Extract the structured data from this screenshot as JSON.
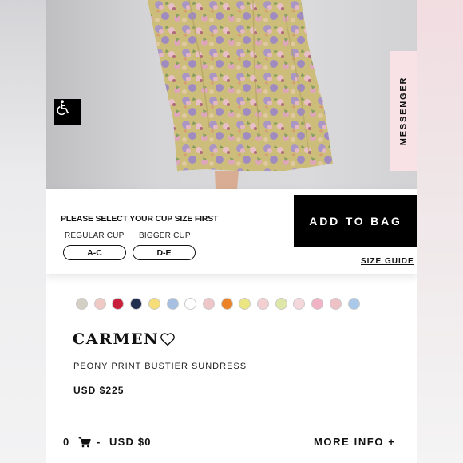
{
  "accessibility": {
    "icon": "wheelchair-icon"
  },
  "messenger": {
    "label": "MESSENGER"
  },
  "size_selector": {
    "prompt": "PLEASE SELECT YOUR CUP SIZE FIRST",
    "regular": {
      "label": "REGULAR CUP",
      "button": "A-C"
    },
    "bigger": {
      "label": "BIGGER CUP",
      "button": "D-E"
    },
    "size_guide": "SIZE GUIDE"
  },
  "add_to_bag": "ADD TO BAG",
  "swatch_colors": [
    "#d3cfc4",
    "#efc9c4",
    "#c8203a",
    "#1f2d4f",
    "#f6dd77",
    "#a7c0e2",
    "#ffffff",
    "#efc6c8",
    "#ec8227",
    "#ece682",
    "#f3cfd2",
    "#dfe7a8",
    "#f5d6db",
    "#f1b2c6",
    "#eec1c7",
    "#a9c8ea"
  ],
  "product": {
    "name": "CARMEN",
    "subtitle": "PEONY PRINT BUSTIER SUNDRESS",
    "price": "USD $225"
  },
  "cart": {
    "count": "0",
    "separator": "-",
    "total": "USD $0",
    "more_info": "MORE INFO +"
  }
}
